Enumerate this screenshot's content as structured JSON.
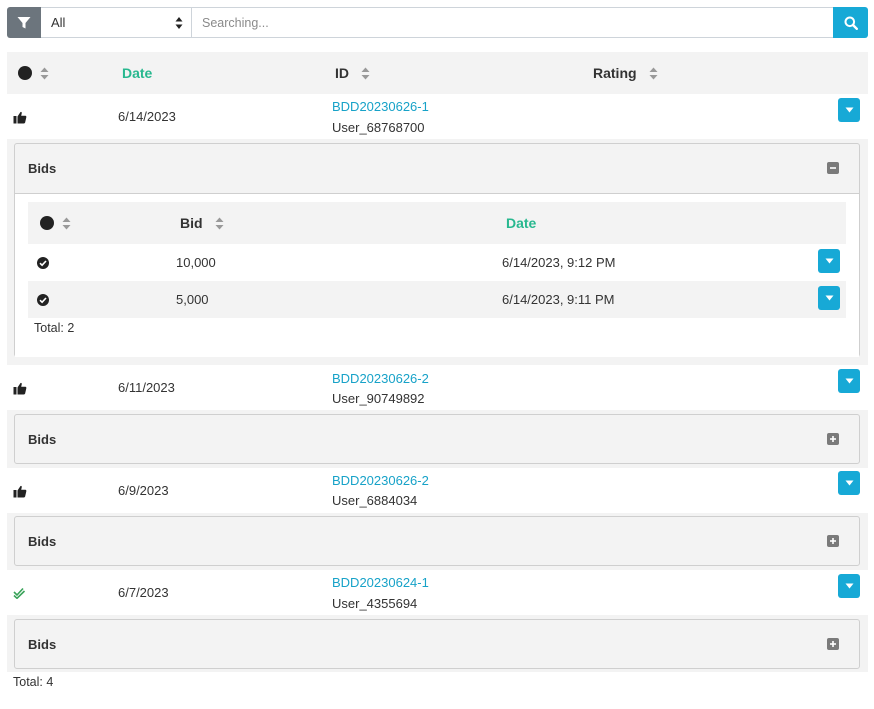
{
  "toolbar": {
    "filter_icon": "funnel-icon",
    "select_value": "All",
    "search_placeholder": "Searching...",
    "search_icon": "magnifier-icon"
  },
  "table": {
    "columns": {
      "status": "",
      "date": "Date",
      "id": "ID",
      "rating": "Rating"
    },
    "rows": [
      {
        "status_icon": "thumbs-up-icon",
        "date": "6/14/2023",
        "id": "BDD20230626-1",
        "user": "User_68768700",
        "bids_title": "Bids",
        "expanded": true,
        "bids": {
          "columns": {
            "status": "",
            "bid": "Bid",
            "date": "Date"
          },
          "rows": [
            {
              "status_icon": "check-circle-icon",
              "bid": "10,000",
              "date": "6/14/2023, 9:12 PM"
            },
            {
              "status_icon": "check-circle-icon",
              "bid": "5,000",
              "date": "6/14/2023, 9:11 PM"
            }
          ],
          "total": "Total: 2"
        }
      },
      {
        "status_icon": "thumbs-up-icon",
        "date": "6/11/2023",
        "id": "BDD20230626-2",
        "user": "User_90749892",
        "bids_title": "Bids",
        "expanded": false
      },
      {
        "status_icon": "thumbs-up-icon",
        "date": "6/9/2023",
        "id": "BDD20230626-2",
        "user": "User_6884034",
        "bids_title": "Bids",
        "expanded": false
      },
      {
        "status_icon": "double-check-icon",
        "date": "6/7/2023",
        "id": "BDD20230624-1",
        "user": "User_4355694",
        "bids_title": "Bids",
        "expanded": false
      }
    ],
    "total": "Total: 4"
  },
  "colors": {
    "accent": "#17a9d6",
    "link": "#17a2c8",
    "sorted_header": "#28b88f",
    "approved_check": "#3aa35a",
    "filter_button": "#6c757d"
  }
}
